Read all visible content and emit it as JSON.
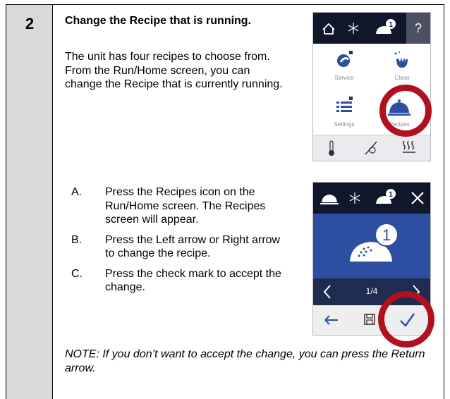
{
  "step": {
    "number": "2",
    "heading": "Change the Recipe that is running.",
    "intro": "The unit has four recipes to choose from. From the Run/Home screen, you can change the Recipe that is currently running."
  },
  "instructions": [
    {
      "label": "A.",
      "text": "Press the Recipes icon on the Run/Home screen. The Recipes screen will appear."
    },
    {
      "label": "B.",
      "text": "Press the Left arrow or Right arrow to change the recipe."
    },
    {
      "label": "C.",
      "text": "Press the check mark to accept the change."
    }
  ],
  "note": "NOTE: If you don’t want to accept the change, you can press the Return arrow.",
  "home_screen": {
    "help_glyph": "?",
    "badge": "1",
    "tiles": {
      "service": "Service",
      "clean": "Clean",
      "settings": "Settings",
      "recipes": "Recipes"
    },
    "icons": [
      "home-icon",
      "snowflake-icon",
      "recipe-badge-icon",
      "help-icon",
      "wrench-icon",
      "clean-hand-icon",
      "list-icon",
      "cloche-icon",
      "thermometer-icon",
      "probe-icon",
      "heat-icon"
    ]
  },
  "recipe_screen": {
    "badge": "1",
    "pager": "1/4",
    "icons": [
      "cloche-icon",
      "snowflake-icon",
      "recipe-badge-icon",
      "close-icon",
      "chevron-left-icon",
      "chevron-right-icon",
      "return-arrow-icon",
      "save-icon",
      "checkmark-icon"
    ]
  },
  "colors": {
    "step_column": "#d9d9d9",
    "top_bar": "#10172a",
    "recipe_panel": "#2d4ea1",
    "nav_bar": "#1d2c4f",
    "highlight_ring": "#b0101f",
    "checkmark": "#2d4ea1"
  }
}
